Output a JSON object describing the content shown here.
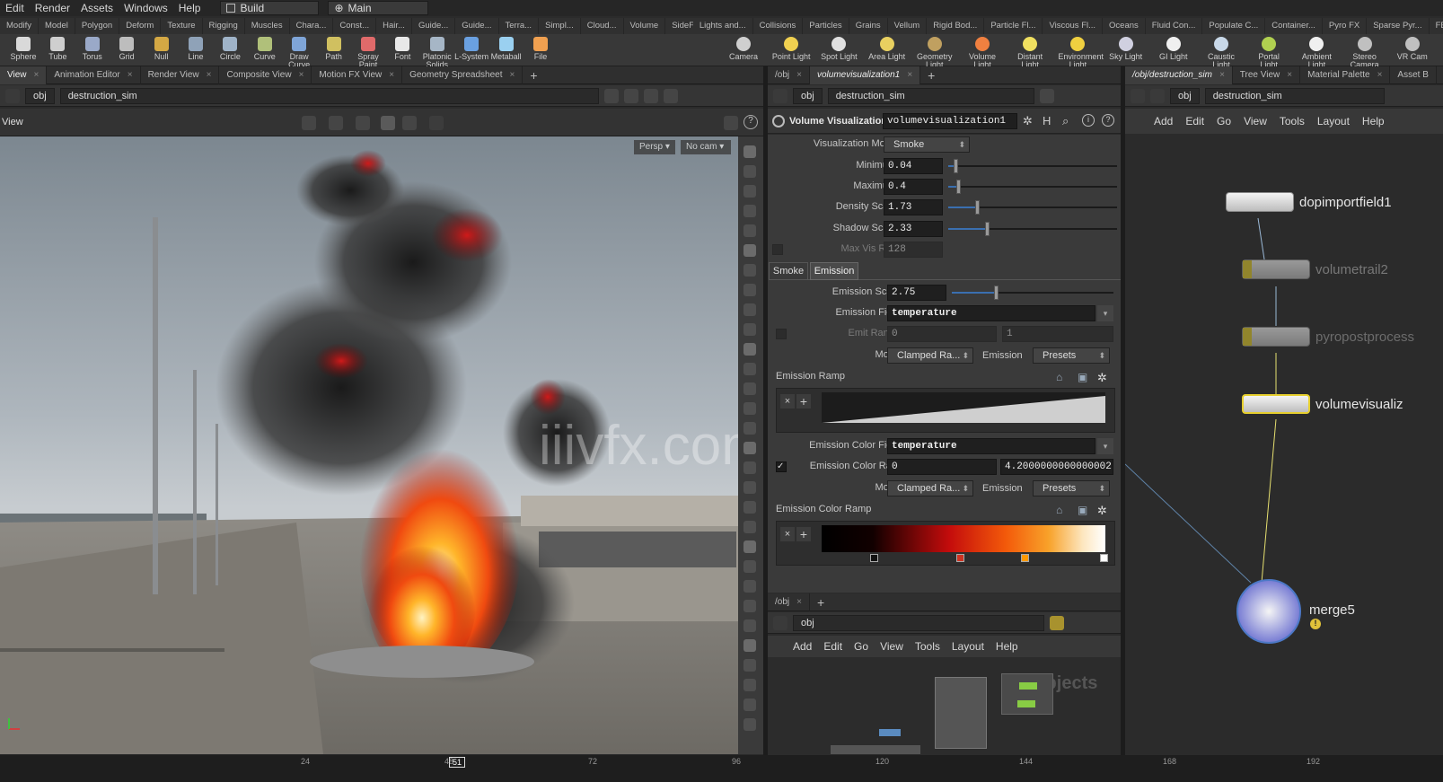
{
  "menu": {
    "items": [
      "Edit",
      "Render",
      "Assets",
      "Windows",
      "Help"
    ],
    "desktop": "Build",
    "context": "Main"
  },
  "shelf": {
    "tabs_left": [
      "Modify",
      "Model",
      "Polygon",
      "Deform",
      "Texture",
      "Rigging",
      "Muscles",
      "Chara...",
      "Const...",
      "Hair...",
      "Guide...",
      "Guide...",
      "Terra...",
      "Simpl...",
      "Cloud...",
      "Volume",
      "SideF..."
    ],
    "tabs_right": [
      "Lights and...",
      "Collisions",
      "Particles",
      "Grains",
      "Vellum",
      "Rigid Bod...",
      "Particle Fl...",
      "Viscous Fl...",
      "Oceans",
      "Fluid Con...",
      "Populate C...",
      "Container...",
      "Pyro FX",
      "Sparse Pyr...",
      "FEM"
    ],
    "tools_left": [
      "Sphere",
      "Tube",
      "Torus",
      "Grid",
      "Null",
      "Line",
      "Circle",
      "Curve",
      "Draw Curve",
      "Path",
      "Spray Paint",
      "Font",
      "Platonic Solids",
      "L-System",
      "Metaball",
      "File"
    ],
    "tools_right": [
      "Camera",
      "Point Light",
      "Spot Light",
      "Area Light",
      "Geometry Light",
      "Volume Light",
      "Distant Light",
      "Environment Light",
      "Sky Light",
      "GI Light",
      "Caustic Light",
      "Portal Light",
      "Ambient Light",
      "Stereo Camera",
      "VR Cam"
    ]
  },
  "left_pane": {
    "tabs": [
      "View",
      "Animation Editor",
      "Render View",
      "Composite View",
      "Motion FX View",
      "Geometry Spreadsheet"
    ],
    "path": [
      "obj",
      "destruction_sim"
    ],
    "view_label": "View",
    "persp": "Persp",
    "cam": "No cam",
    "watermark": "iiivfx.com",
    "axis_x": "x",
    "axis_y": "y"
  },
  "param_pane": {
    "tabs": [
      "/obj",
      "volumevisualization1"
    ],
    "path": [
      "obj",
      "destruction_sim"
    ],
    "node_type": "Volume Visualization",
    "node_name": "volumevisualization1",
    "params": {
      "vis_mode": {
        "label": "Visualization Mode",
        "value": "Smoke"
      },
      "minimum": {
        "label": "Minimum",
        "value": "0.04",
        "level": 0.04
      },
      "maximum": {
        "label": "Maximum",
        "value": "0.4",
        "level": 0.06
      },
      "density_scale": {
        "label": "Density Scale",
        "value": "1.73",
        "level": 0.17
      },
      "shadow_scale": {
        "label": "Shadow Scale",
        "value": "2.33",
        "level": 0.23
      },
      "max_vis_res": {
        "label": "Max Vis Res",
        "value": "128"
      }
    },
    "subtabs": [
      "Smoke",
      "Emission"
    ],
    "emission": {
      "scale": {
        "label": "Emission Scale",
        "value": "2.75",
        "level": 0.27
      },
      "field": {
        "label": "Emission Field",
        "value": "temperature"
      },
      "emit_range": {
        "label": "Emit Range",
        "v1": "0",
        "v2": "1"
      },
      "mode": {
        "label": "Mode",
        "value": "Clamped Ra...",
        "emission_label": "Emission",
        "presets": "Presets"
      },
      "ramp_label": "Emission Ramp",
      "color_field": {
        "label": "Emission Color Field",
        "value": "temperature"
      },
      "color_range": {
        "label": "Emission Color Ra...",
        "v1": "0",
        "v2": "4.2000000000000002"
      },
      "mode2": {
        "label": "Mode",
        "value": "Clamped Ra...",
        "emission_label": "Emission",
        "presets": "Presets"
      },
      "color_ramp_label": "Emission Color Ramp"
    }
  },
  "lower_net": {
    "tabs": [
      "/obj"
    ],
    "path": "obj",
    "menu": [
      "Add",
      "Edit",
      "Go",
      "View",
      "Tools",
      "Layout",
      "Help"
    ],
    "watermark_label": "Objects"
  },
  "right_net": {
    "tabs": [
      "/obj/destruction_sim",
      "Tree View",
      "Material Palette",
      "Asset B"
    ],
    "path": [
      "obj",
      "destruction_sim"
    ],
    "menu": [
      "Add",
      "Edit",
      "Go",
      "View",
      "Tools",
      "Layout",
      "Help"
    ],
    "nodes": [
      "dopimportfield1",
      "volumetrail2",
      "pyropostprocess",
      "volumevisualiz",
      "merge5"
    ]
  },
  "timeline": {
    "ticks": [
      "24",
      "48",
      "72",
      "96",
      "120",
      "144",
      "168",
      "192"
    ],
    "frame": "51"
  }
}
